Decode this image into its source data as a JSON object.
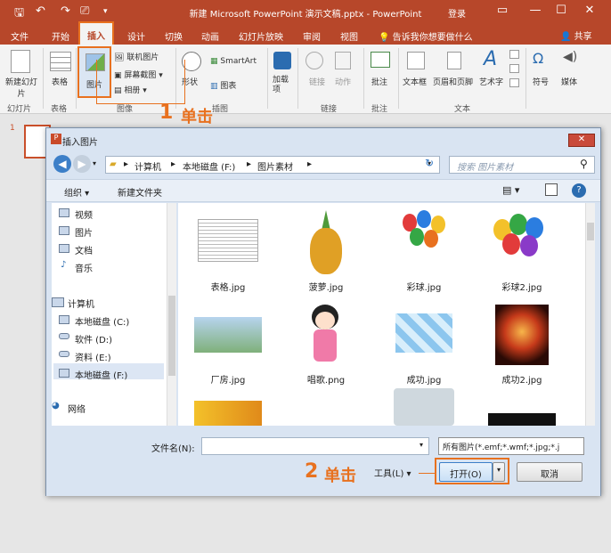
{
  "window": {
    "title": "新建 Microsoft PowerPoint 演示文稿.pptx - PowerPoint",
    "login": "登录"
  },
  "tabs": [
    "文件",
    "开始",
    "插入",
    "设计",
    "切换",
    "动画",
    "幻灯片放映",
    "审阅",
    "视图"
  ],
  "tell_me": "告诉我你想要做什么",
  "share": "共享",
  "ribbon": {
    "new_slide": "新建幻灯片",
    "table": "表格",
    "picture": "图片",
    "online_picture": "联机图片",
    "screenshot": "屏幕截图",
    "album": "相册",
    "shapes": "形状",
    "smartart": "SmartArt",
    "chart": "图表",
    "addins": "加载项",
    "link": "链接",
    "action": "动作",
    "comment": "批注",
    "textbox": "文本框",
    "header_footer": "页眉和页脚",
    "wordart": "艺术字",
    "symbol": "符号",
    "media": "媒体",
    "groups": {
      "slides": "幻灯片",
      "tables": "表格",
      "images": "图像",
      "illustrations": "插图",
      "links": "链接",
      "comments": "批注",
      "text": "文本"
    }
  },
  "slide_number": "1",
  "annotations": {
    "step1": "单击",
    "step1_num": "1",
    "step2": "单击",
    "step2_num": "2"
  },
  "dialog": {
    "title": "插入图片",
    "path": [
      "计算机",
      "本地磁盘 (F:)",
      "图片素材"
    ],
    "search_placeholder": "搜索 图片素材",
    "organize": "组织",
    "new_folder": "新建文件夹",
    "nav": [
      {
        "label": "视频"
      },
      {
        "label": "图片"
      },
      {
        "label": "文档"
      },
      {
        "label": "音乐"
      },
      {
        "label": "计算机"
      },
      {
        "label": "本地磁盘 (C:)"
      },
      {
        "label": "软件 (D:)"
      },
      {
        "label": "资料 (E:)"
      },
      {
        "label": "本地磁盘 (F:)"
      },
      {
        "label": "网络"
      }
    ],
    "files": [
      "表格.jpg",
      "菠萝.jpg",
      "彩球.jpg",
      "彩球2.jpg",
      "厂房.jpg",
      "唱歌.png",
      "成功.jpg",
      "成功2.jpg"
    ],
    "filename_label": "文件名(N):",
    "filename_value": "",
    "filter": "所有图片(*.emf;*.wmf;*.jpg;*.j",
    "tools": "工具(L)",
    "open": "打开(O)",
    "cancel": "取消"
  }
}
